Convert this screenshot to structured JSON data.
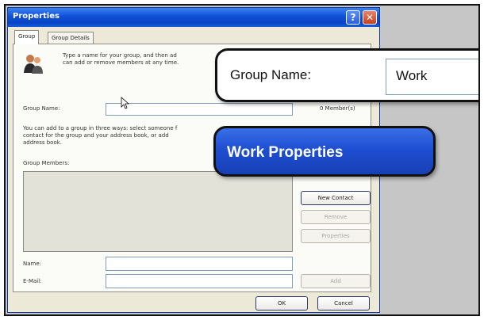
{
  "window": {
    "title": "Properties",
    "help_glyph": "?",
    "close_glyph": "✕"
  },
  "tabs": {
    "group": "Group",
    "group_details": "Group Details"
  },
  "panel": {
    "intro_line1": "Type a name for your group, and then ad",
    "intro_line2": "can add or remove members at any time.",
    "group_name_label": "Group Name:",
    "member_count": "0 Member(s)",
    "help_line1": "You can add to a group in three ways: select someone f",
    "help_line2": "contact for the group and your address book, or add",
    "help_line3": "address book.",
    "group_members_label": "Group Members:",
    "name_label": "Name:",
    "email_label": "E-Mail:"
  },
  "buttons": {
    "new_contact": "New Contact",
    "remove": "Remove",
    "properties": "Properties",
    "add": "Add",
    "ok": "OK",
    "cancel": "Cancel"
  },
  "callouts": {
    "group_name_label": "Group Name:",
    "group_name_value": "Work",
    "window_title": "Work Properties"
  },
  "icons": [
    "people-icon",
    "pointer-cursor-icon",
    "help-icon",
    "close-icon"
  ]
}
